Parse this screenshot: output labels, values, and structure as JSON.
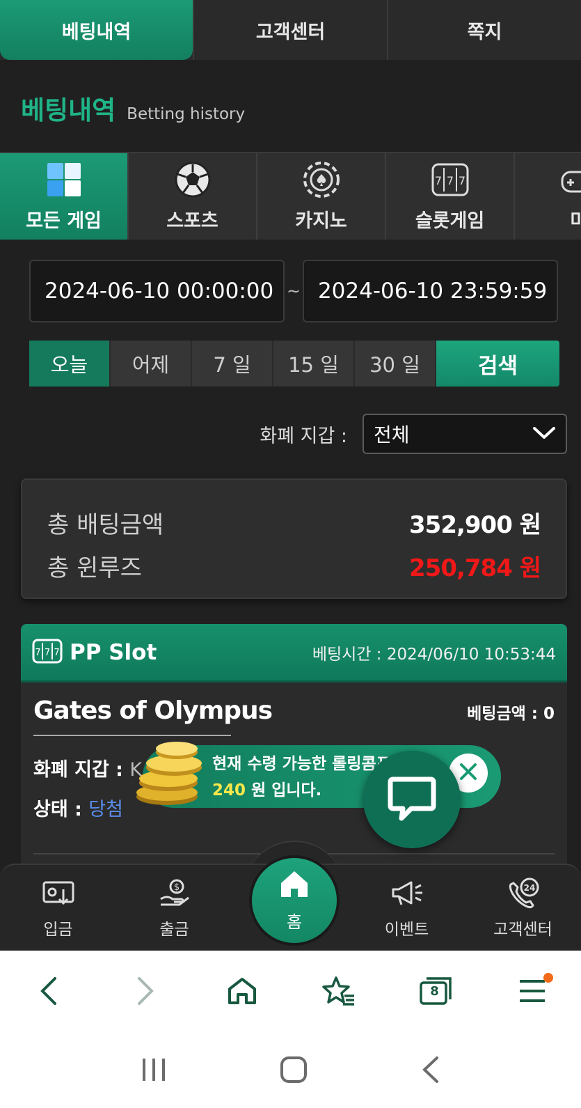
{
  "top_tabs": [
    "베팅내역",
    "고객센터",
    "쪽지"
  ],
  "heading": {
    "ko": "베팅내역",
    "en": "Betting history"
  },
  "game_tabs": [
    {
      "label": "모든 게임",
      "icon": "all-games-icon"
    },
    {
      "label": "스포츠",
      "icon": "soccer-ball-icon"
    },
    {
      "label": "카지노",
      "icon": "casino-chip-icon"
    },
    {
      "label": "슬롯게임",
      "icon": "slot-machine-icon"
    },
    {
      "label": "미",
      "icon": "gamepad-icon"
    }
  ],
  "date_range": {
    "start": "2024-06-10 00:00:00",
    "separator": "~",
    "end": "2024-06-10 23:59:59"
  },
  "periods": [
    "오늘",
    "어제",
    "7 일",
    "15 일",
    "30 일"
  ],
  "search_label": "검색",
  "wallet": {
    "label": "화폐 지갑 :",
    "selected": "전체"
  },
  "totals": {
    "bet_label": "총 배팅금액",
    "bet_value": "352,900 원",
    "winloss_label": "총 윈루즈",
    "winloss_value": "250,784 원"
  },
  "card": {
    "provider": "PP Slot",
    "bet_time": "베팅시간 : 2024/06/10 10:53:44",
    "game_name": "Gates of Olympus",
    "bet_amount": "베팅금액 : 0",
    "wallet_label": "화폐 지갑 :",
    "wallet_value": "K",
    "status_label": "상태 :",
    "status_value": "당첨"
  },
  "promo": {
    "line1": "현재 수령 가능한 롤링콤프",
    "amount": "240",
    "line2": " 원 입니다."
  },
  "bottom_nav": [
    {
      "label": "입금",
      "icon": "deposit-icon"
    },
    {
      "label": "출금",
      "icon": "withdraw-icon"
    },
    {
      "label": "홈",
      "icon": "home-icon"
    },
    {
      "label": "이벤트",
      "icon": "megaphone-icon"
    },
    {
      "label": "고객센터",
      "icon": "support-24-icon"
    }
  ],
  "browser": {
    "tab_count": "8"
  },
  "colors": {
    "accent": "#1a9a73",
    "win_red": "#f01818",
    "status_blue": "#5b8dea",
    "promo_yellow": "#f7e94a"
  }
}
